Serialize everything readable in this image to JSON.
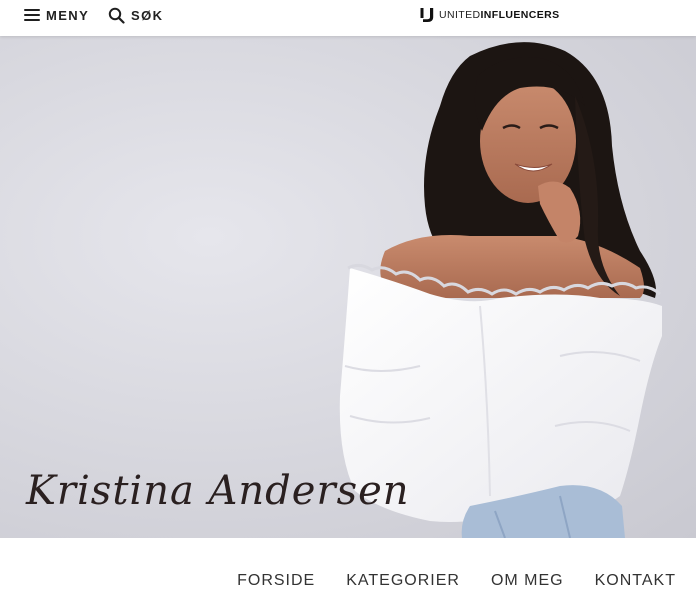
{
  "header": {
    "menu_label": "MENY",
    "search_label": "SØK",
    "brand": {
      "light": "UNITED",
      "bold": "INFLUENCERS"
    }
  },
  "hero": {
    "title": "Kristina Andersen"
  },
  "nav": {
    "items": [
      {
        "label": "FORSIDE"
      },
      {
        "label": "KATEGORIER"
      },
      {
        "label": "OM MEG"
      },
      {
        "label": "KONTAKT"
      }
    ]
  },
  "colors": {
    "background": "#ffffff",
    "hero_wall": "#d6d6dd",
    "text": "#222222"
  }
}
